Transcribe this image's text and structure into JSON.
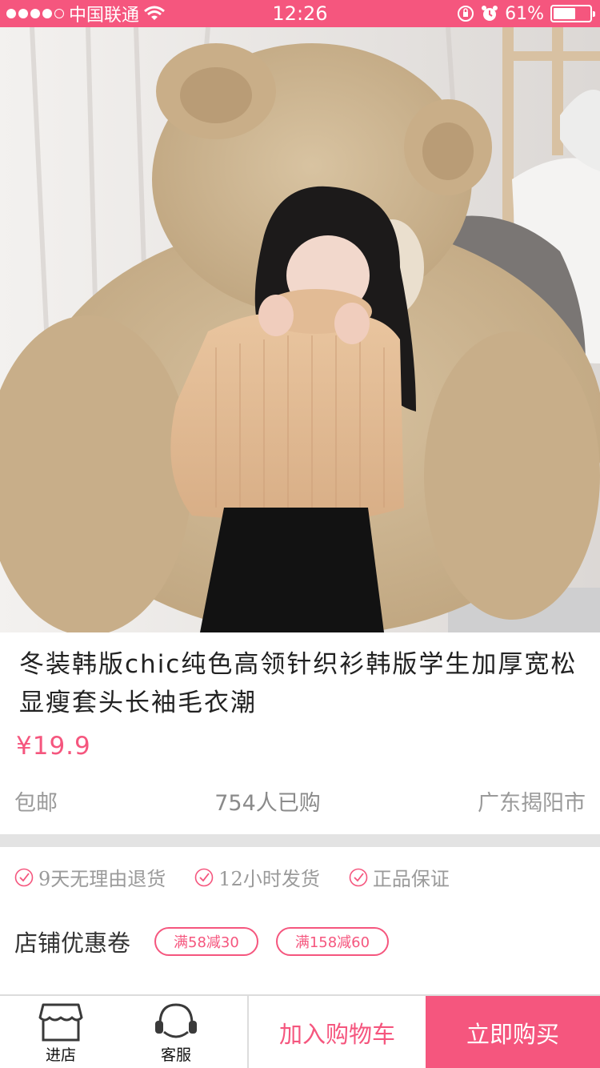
{
  "status_bar": {
    "carrier": "中国联通",
    "time": "12:26",
    "battery_percent": "61%",
    "battery_level": 0.61,
    "signal_bars_filled": 4,
    "icons": [
      "signal-dots-icon",
      "wifi-icon",
      "orientation-lock-icon",
      "alarm-icon",
      "battery-icon"
    ]
  },
  "product": {
    "title": "冬装韩版chic纯色高领针织衫韩版学生加厚宽松显瘦套头长袖毛衣潮",
    "price": "¥19.9",
    "shipping": "包邮",
    "sold": "754人已购",
    "location": "广东揭阳市"
  },
  "guarantees": [
    "9天无理由退货",
    "12小时发货",
    "正品保证"
  ],
  "coupons": {
    "label": "店铺优惠卷",
    "items": [
      "满58减30",
      "满158减60"
    ]
  },
  "bottom_bar": {
    "store_label": "进店",
    "service_label": "客服",
    "add_to_cart": "加入购物车",
    "buy_now": "立即购买"
  },
  "colors": {
    "accent": "#f5567e",
    "text_primary": "#222222",
    "text_secondary": "#9a9a9a",
    "divider": "#e3e3e3"
  }
}
